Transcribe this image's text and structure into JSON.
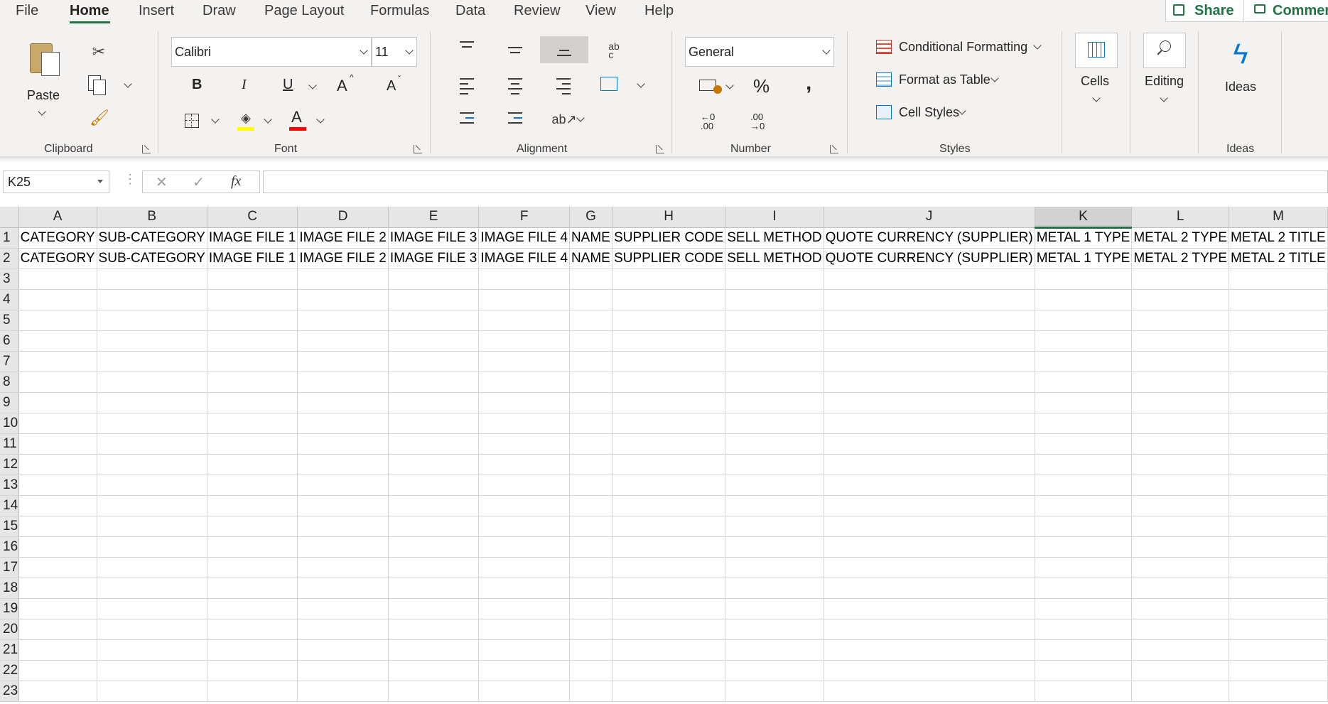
{
  "tabs": [
    "File",
    "Home",
    "Insert",
    "Draw",
    "Page Layout",
    "Formulas",
    "Data",
    "Review",
    "View",
    "Help"
  ],
  "active_tab": "Home",
  "share_label": "Share",
  "comments_label": "Commen",
  "ribbon": {
    "clipboard": {
      "label": "Clipboard",
      "paste_label": "Paste"
    },
    "font": {
      "label": "Font",
      "font_name": "Calibri",
      "font_size": "11",
      "bold": "B",
      "italic": "I",
      "underline": "U",
      "grow": "A",
      "shrink": "A",
      "color_letter": "A",
      "highlight_color": "#ffff00",
      "font_color": "#ff0000"
    },
    "alignment": {
      "label": "Alignment"
    },
    "number": {
      "label": "Number",
      "format": "General",
      "percent": "%",
      "comma": ",",
      "inc_decimal": "←0 .00",
      "dec_decimal": ".00 →0"
    },
    "styles": {
      "label": "Styles",
      "conditional": "Conditional Formatting",
      "format_table": "Format as Table",
      "cell_styles": "Cell Styles"
    },
    "cells": {
      "label": "Cells"
    },
    "editing": {
      "label": "Editing"
    },
    "ideas": {
      "label": "Ideas",
      "group_label": "Ideas"
    }
  },
  "formula_bar": {
    "name_box": "K25",
    "fx": "fx",
    "value": ""
  },
  "accent_color": "#217346",
  "columns": [
    "A",
    "B",
    "C",
    "D",
    "E",
    "F",
    "G",
    "H",
    "I",
    "J",
    "K",
    "L",
    "M"
  ],
  "selected_column": "K",
  "rows": [
    [
      "CATEGORY",
      "SUB-CATEGORY",
      "IMAGE FILE 1",
      "IMAGE FILE 2",
      "IMAGE FILE 3",
      "IMAGE FILE 4",
      "NAME",
      "SUPPLIER CODE",
      "SELL METHOD",
      "QUOTE CURRENCY (SUPPLIER)",
      "METAL 1 TYPE",
      "METAL 2 TYPE",
      "METAL 2 TITLE"
    ],
    [
      "CATEGORY",
      "SUB-CATEGORY",
      "IMAGE FILE 1",
      "IMAGE FILE 2",
      "IMAGE FILE 3",
      "IMAGE FILE 4",
      "NAME",
      "SUPPLIER CODE",
      "SELL METHOD",
      "QUOTE CURRENCY (SUPPLIER)",
      "METAL 1 TYPE",
      "METAL 2 TYPE",
      "METAL 2 TITLE"
    ]
  ],
  "row_numbers": [
    "1",
    "2",
    "3",
    "4",
    "5",
    "6",
    "7",
    "8",
    "9",
    "10",
    "11",
    "12",
    "13",
    "14",
    "15",
    "16",
    "17",
    "18",
    "19",
    "20",
    "21",
    "22",
    "23"
  ]
}
